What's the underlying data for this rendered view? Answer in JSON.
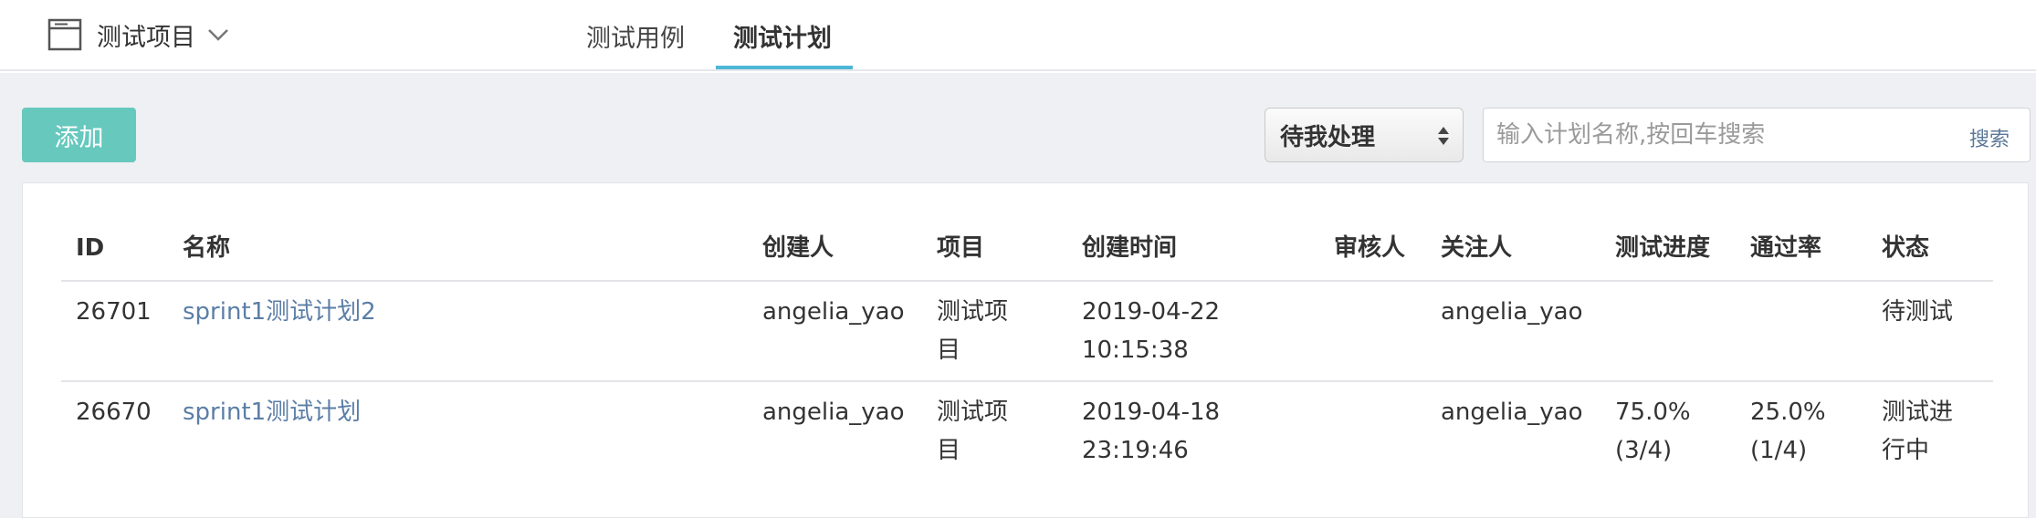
{
  "header": {
    "project_name": "测试项目",
    "tabs": [
      {
        "label": "测试用例",
        "active": false
      },
      {
        "label": "测试计划",
        "active": true
      }
    ],
    "accent_color": "#4fb7d6"
  },
  "toolbar": {
    "add_label": "添加",
    "filter_selected": "待我处理",
    "search_placeholder": "输入计划名称,按回车搜索",
    "search_label": "搜索",
    "add_color": "#67c8be"
  },
  "table": {
    "columns": [
      "ID",
      "名称",
      "创建人",
      "项目",
      "创建时间",
      "审核人",
      "关注人",
      "测试进度",
      "通过率",
      "状态"
    ],
    "rows": [
      {
        "id": "26701",
        "name": "sprint1测试计划2",
        "creator": "angelia_yao",
        "project_line1": "测试项",
        "project_line2": "目",
        "created_date": "2019-04-22",
        "created_time": "10:15:38",
        "reviewer": "",
        "follower": "angelia_yao",
        "progress_line1": "",
        "progress_line2": "",
        "pass_line1": "",
        "pass_line2": "",
        "status_line1": "待测试",
        "status_line2": ""
      },
      {
        "id": "26670",
        "name": "sprint1测试计划",
        "creator": "angelia_yao",
        "project_line1": "测试项",
        "project_line2": "目",
        "created_date": "2019-04-18",
        "created_time": "23:19:46",
        "reviewer": "",
        "follower": "angelia_yao",
        "progress_line1": "75.0%",
        "progress_line2": "(3/4)",
        "pass_line1": "25.0%",
        "pass_line2": "(1/4)",
        "status_line1": "测试进",
        "status_line2": "行中"
      }
    ]
  }
}
